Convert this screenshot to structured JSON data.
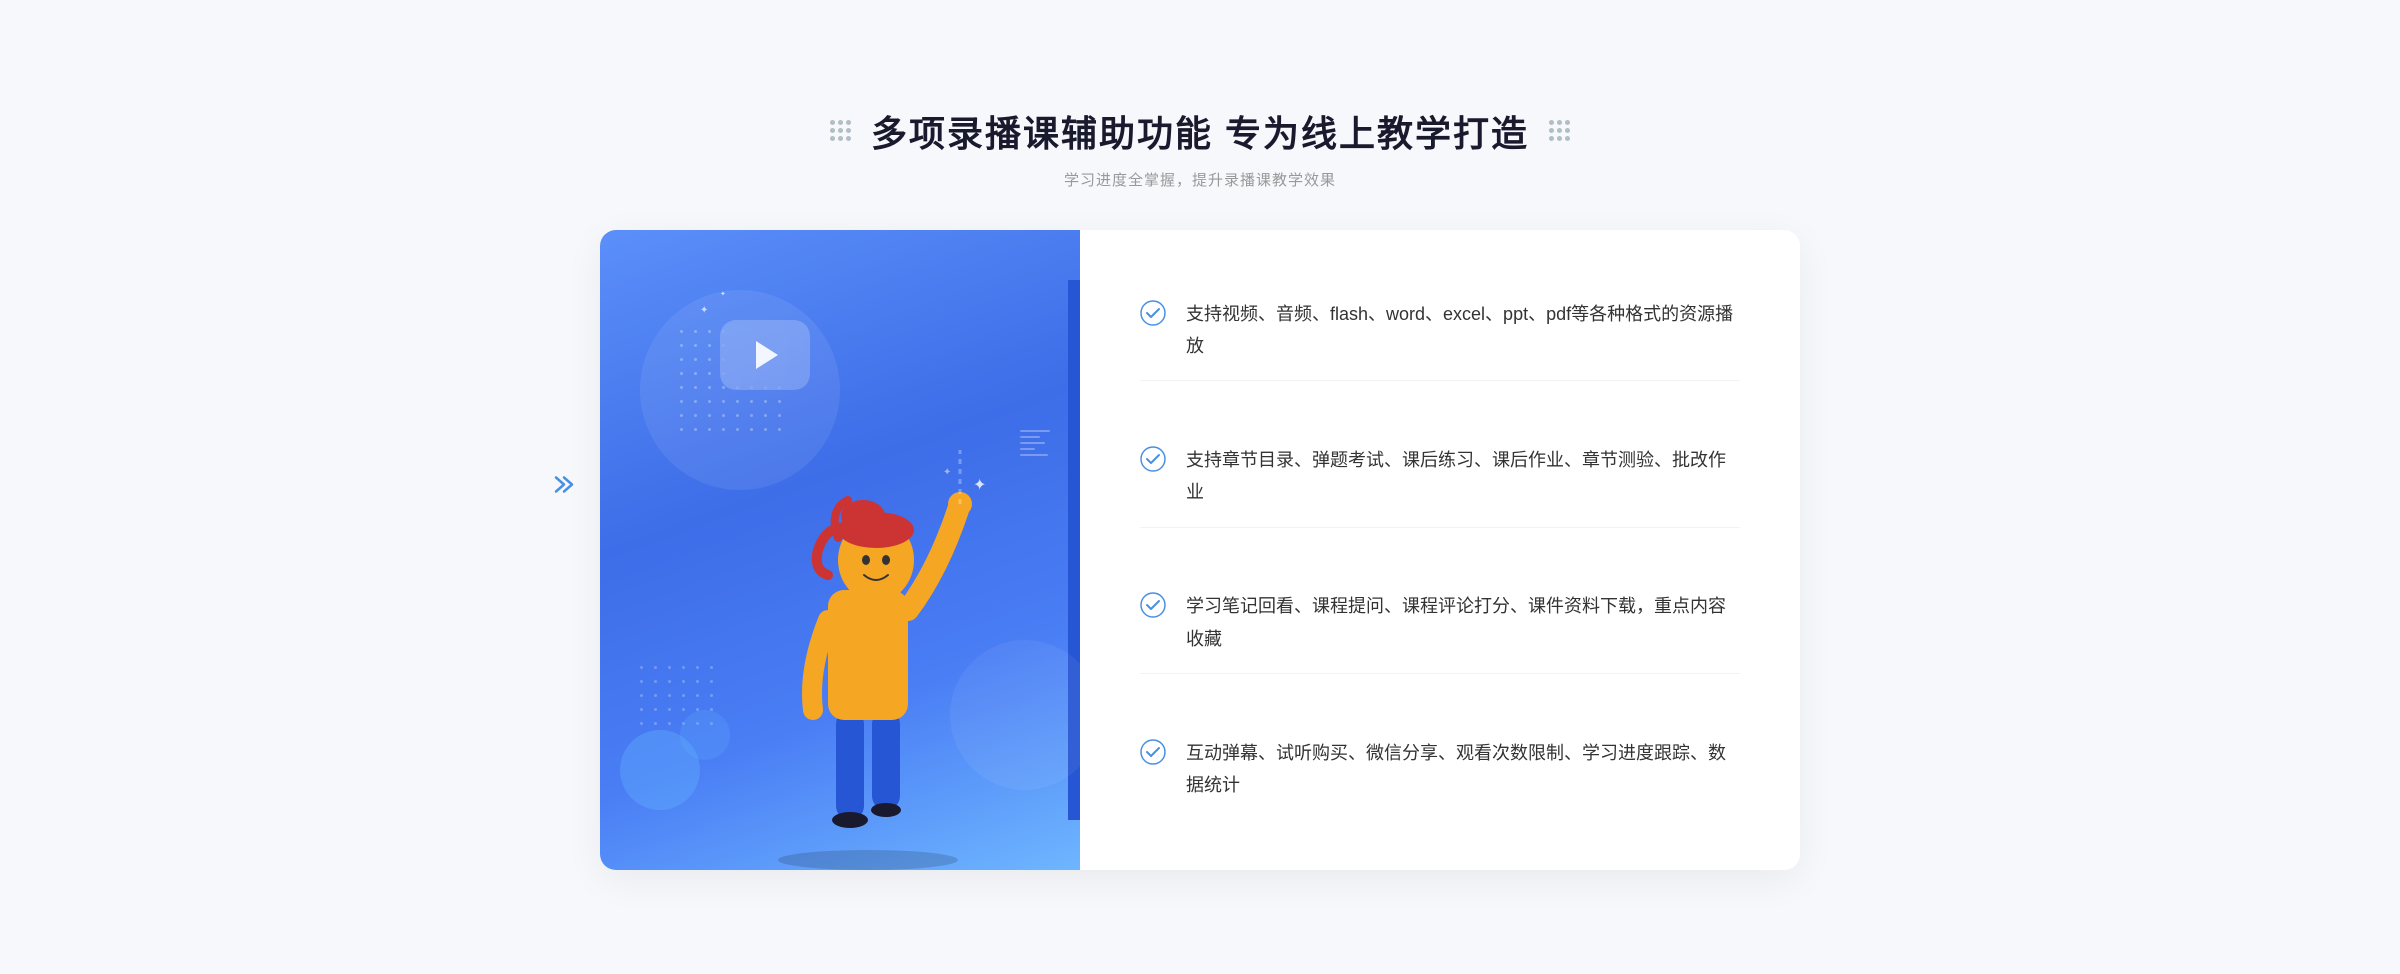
{
  "header": {
    "title": "多项录播课辅助功能 专为线上教学打造",
    "subtitle": "学习进度全掌握，提升录播课教学效果"
  },
  "features": [
    {
      "id": "feature-1",
      "text": "支持视频、音频、flash、word、excel、ppt、pdf等各种格式的资源播放"
    },
    {
      "id": "feature-2",
      "text": "支持章节目录、弹题考试、课后练习、课后作业、章节测验、批改作业"
    },
    {
      "id": "feature-3",
      "text": "学习笔记回看、课程提问、课程评论打分、课件资料下载，重点内容收藏"
    },
    {
      "id": "feature-4",
      "text": "互动弹幕、试听购买、微信分享、观看次数限制、学习进度跟踪、数据统计"
    }
  ],
  "colors": {
    "primary": "#4a7ef5",
    "title": "#1a1a2e",
    "text": "#333333",
    "subtitle": "#999999",
    "check": "#4a90e2",
    "border": "#f0f2f5"
  }
}
